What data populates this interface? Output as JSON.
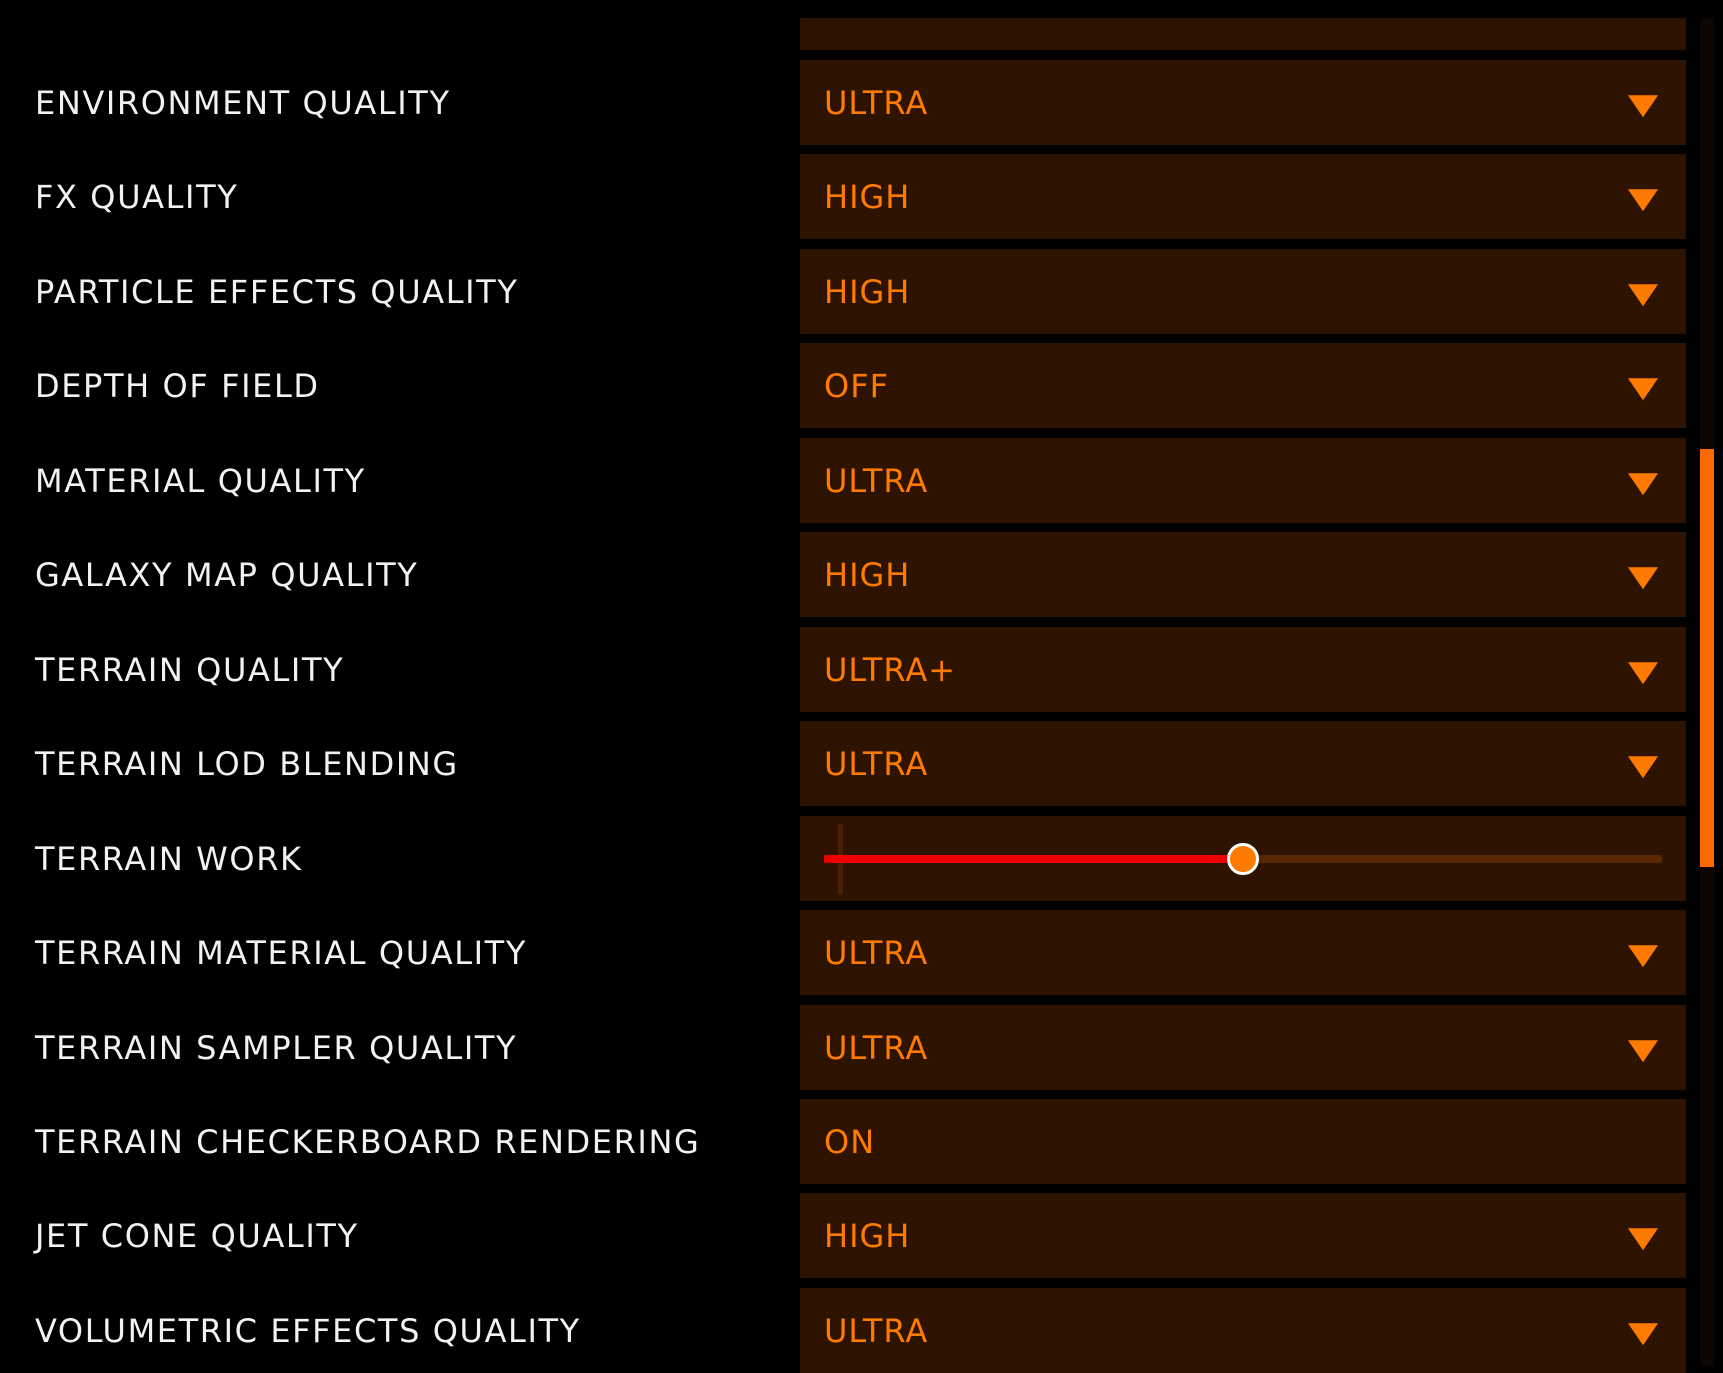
{
  "colors": {
    "background": "#000000",
    "label_text": "#f2f2f2",
    "accent": "#ff7a00",
    "control_bg": "#2e1400",
    "slider_fill": "#ee0000",
    "slider_track": "#5a2800"
  },
  "settings": [
    {
      "label": "ENVIRONMENT QUALITY",
      "type": "dropdown",
      "value": "ULTRA"
    },
    {
      "label": "FX QUALITY",
      "type": "dropdown",
      "value": "HIGH"
    },
    {
      "label": "PARTICLE EFFECTS QUALITY",
      "type": "dropdown",
      "value": "HIGH"
    },
    {
      "label": "DEPTH OF FIELD",
      "type": "dropdown",
      "value": "OFF"
    },
    {
      "label": "MATERIAL QUALITY",
      "type": "dropdown",
      "value": "ULTRA"
    },
    {
      "label": "GALAXY MAP QUALITY",
      "type": "dropdown",
      "value": "HIGH"
    },
    {
      "label": "TERRAIN QUALITY",
      "type": "dropdown",
      "value": "ULTRA+"
    },
    {
      "label": "TERRAIN LOD BLENDING",
      "type": "dropdown",
      "value": "ULTRA"
    },
    {
      "label": "TERRAIN WORK",
      "type": "slider",
      "level": 0.5
    },
    {
      "label": "TERRAIN MATERIAL QUALITY",
      "type": "dropdown",
      "value": "ULTRA"
    },
    {
      "label": "TERRAIN SAMPLER QUALITY",
      "type": "dropdown",
      "value": "ULTRA"
    },
    {
      "label": "TERRAIN CHECKERBOARD RENDERING",
      "type": "toggle",
      "value": "ON"
    },
    {
      "label": "JET CONE QUALITY",
      "type": "dropdown",
      "value": "HIGH"
    },
    {
      "label": "VOLUMETRIC EFFECTS QUALITY",
      "type": "dropdown",
      "value": "ULTRA"
    }
  ],
  "scrollbar": {
    "thumb_start_fraction": 0.32,
    "thumb_size_fraction": 0.31
  }
}
